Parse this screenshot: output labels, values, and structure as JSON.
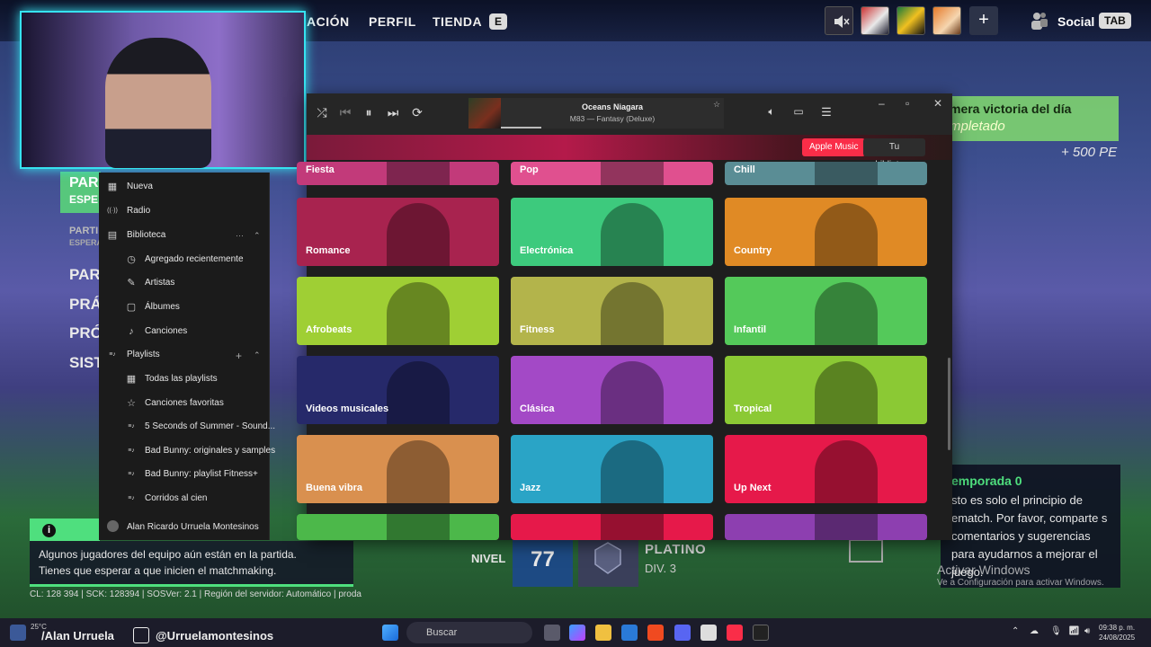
{
  "game": {
    "nav": [
      "ACIÓN",
      "PERFIL",
      "TIENDA"
    ],
    "shop_key": "E",
    "social_label": "Social",
    "social_key": "TAB",
    "plus": "+",
    "challenge": {
      "title": "mera victoria del día",
      "status": "mpletado",
      "reward": "+ 500 PE"
    },
    "left_tags": [
      "PAR",
      "ESPE",
      "PARTI",
      "ESPERA"
    ],
    "left_menu": [
      "PAR",
      "PRÁ",
      "PRÓ",
      "SIST"
    ],
    "notice": {
      "lines": [
        "Algunos jugadores del equipo aún están en la partida.",
        "Tienes que esperar a que inicien el matchmaking."
      ]
    },
    "server_info": "CL: 128 394 | SCK: 128394 | SOSVer: 2.1 | Región del servidor: Automático | proda",
    "level_label": "NIVEL",
    "level_value": "77",
    "rank_name": "PLATINO",
    "rank_div": "DIV. 3",
    "season": {
      "title": "emporada 0",
      "text": "sto es solo el principio de ematch. Por favor, comparte s comentarios y sugerencias para ayudarnos a mejorar el juego."
    },
    "watermark": {
      "title": "Activar Windows",
      "subtitle": "Ve a Configuración para activar Windows."
    }
  },
  "music": {
    "now_playing": {
      "title": "Oceans Niagara",
      "subtitle": "M83 — Fantasy (Deluxe)"
    },
    "tabs": {
      "apple_music": "Apple Music",
      "library": "Tu biblioteca"
    },
    "sidebar": {
      "items": [
        {
          "label": "Nueva",
          "icon": "grid-icon"
        },
        {
          "label": "Radio",
          "icon": "radio-icon"
        },
        {
          "label": "Biblioteca",
          "icon": "library-icon"
        },
        {
          "label": "Agregado recientemente",
          "icon": "clock-icon"
        },
        {
          "label": "Artistas",
          "icon": "mic-icon"
        },
        {
          "label": "Álbumes",
          "icon": "album-icon"
        },
        {
          "label": "Canciones",
          "icon": "note-icon"
        },
        {
          "label": "Playlists",
          "icon": "playlist-icon"
        },
        {
          "label": "Todas las playlists",
          "icon": "grid-icon"
        },
        {
          "label": "Canciones favoritas",
          "icon": "star-icon"
        },
        {
          "label": "5 Seconds of Summer - Sound...",
          "icon": "playlist-icon"
        },
        {
          "label": "Bad Bunny: originales y samples",
          "icon": "playlist-icon"
        },
        {
          "label": "Bad Bunny: playlist Fitness+",
          "icon": "playlist-icon"
        },
        {
          "label": "Corridos al cien",
          "icon": "playlist-icon"
        }
      ],
      "user": "Alan Ricardo Urruela Montesinos"
    },
    "genres": [
      {
        "label": "Fiesta",
        "color": "#c23a7a"
      },
      {
        "label": "Pop",
        "color": "#e0508f"
      },
      {
        "label": "Chill",
        "color": "#5a8d95"
      },
      {
        "label": "Romance",
        "color": "#a8234f"
      },
      {
        "label": "Electrónica",
        "color": "#3dca7d"
      },
      {
        "label": "Country",
        "color": "#e08a25"
      },
      {
        "label": "Afrobeats",
        "color": "#9fcf34"
      },
      {
        "label": "Fitness",
        "color": "#b3b44b"
      },
      {
        "label": "Infantil",
        "color": "#54c95a"
      },
      {
        "label": "Videos musicales",
        "color": "#26296a"
      },
      {
        "label": "Clásica",
        "color": "#a349c6"
      },
      {
        "label": "Tropical",
        "color": "#8bc934"
      },
      {
        "label": "Buena vibra",
        "color": "#d9904f"
      },
      {
        "label": "Jazz",
        "color": "#2aa4c6"
      },
      {
        "label": "Up Next",
        "color": "#e6194a"
      },
      {
        "label": "",
        "color": "#4cb84a"
      },
      {
        "label": "",
        "color": "#e6194a"
      },
      {
        "label": "",
        "color": "#8d3fb0"
      }
    ]
  },
  "taskbar": {
    "handle1": "/Alan Urruela",
    "handle2": "@Urruelamontesinos",
    "weather": "25°C",
    "search": "Buscar",
    "time": "09:38 p. m.",
    "date": "24/08/2025"
  }
}
